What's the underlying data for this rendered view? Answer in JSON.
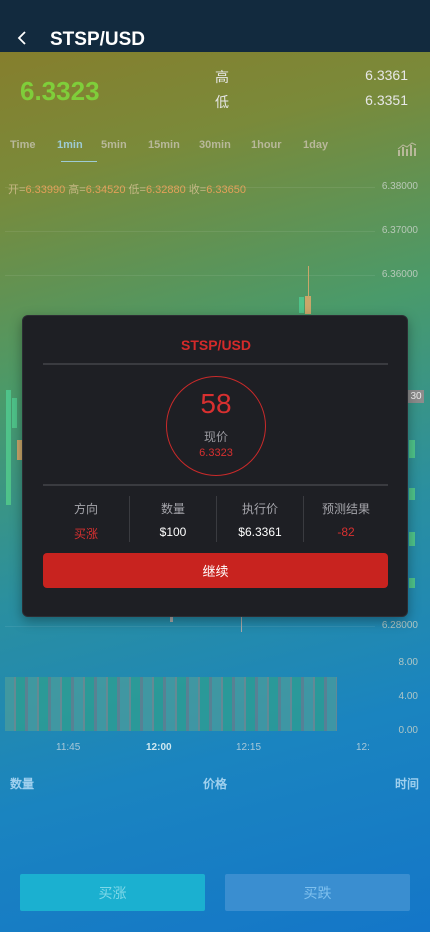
{
  "header": {
    "title": "STSP/USD"
  },
  "ticker": {
    "price": "6.3323",
    "high_label": "高",
    "high_value": "6.3361",
    "low_label": "低",
    "low_value": "6.3351"
  },
  "tabs": [
    "Time",
    "1min",
    "5min",
    "15min",
    "30min",
    "1hour",
    "1day"
  ],
  "active_tab": "1min",
  "ohlc": {
    "open_label": "开=",
    "open": "6.33990",
    "high_label": "高=",
    "high": "6.34520",
    "low_label": "低=",
    "low": "6.32880",
    "close_label": "收=",
    "close": "6.33650"
  },
  "y_axis": [
    "6.38000",
    "6.37000",
    "6.36000",
    "6.28000"
  ],
  "y_marker": "30",
  "volume_axis": [
    "8.00",
    "4.00",
    "0.00"
  ],
  "x_axis": [
    "11:45",
    "12:00",
    "12:15",
    "12:"
  ],
  "bottom_headers": {
    "qty": "数量",
    "price": "价格",
    "time": "时间"
  },
  "buttons": {
    "buy": "买涨",
    "sell": "买跌"
  },
  "modal": {
    "title": "STSP/USD",
    "countdown": "58",
    "current_label": "现价",
    "current_price": "6.3323",
    "columns": [
      {
        "header": "方向",
        "value": "买涨"
      },
      {
        "header": "数量",
        "value": "$100"
      },
      {
        "header": "执行价",
        "value": "$6.3361"
      },
      {
        "header": "预测结果",
        "value": "-82"
      }
    ],
    "confirm_label": "继续"
  },
  "colors": {
    "accent_red": "#c8231f",
    "price_green": "#7fce3a",
    "candle_up": "#3dbf7f"
  }
}
